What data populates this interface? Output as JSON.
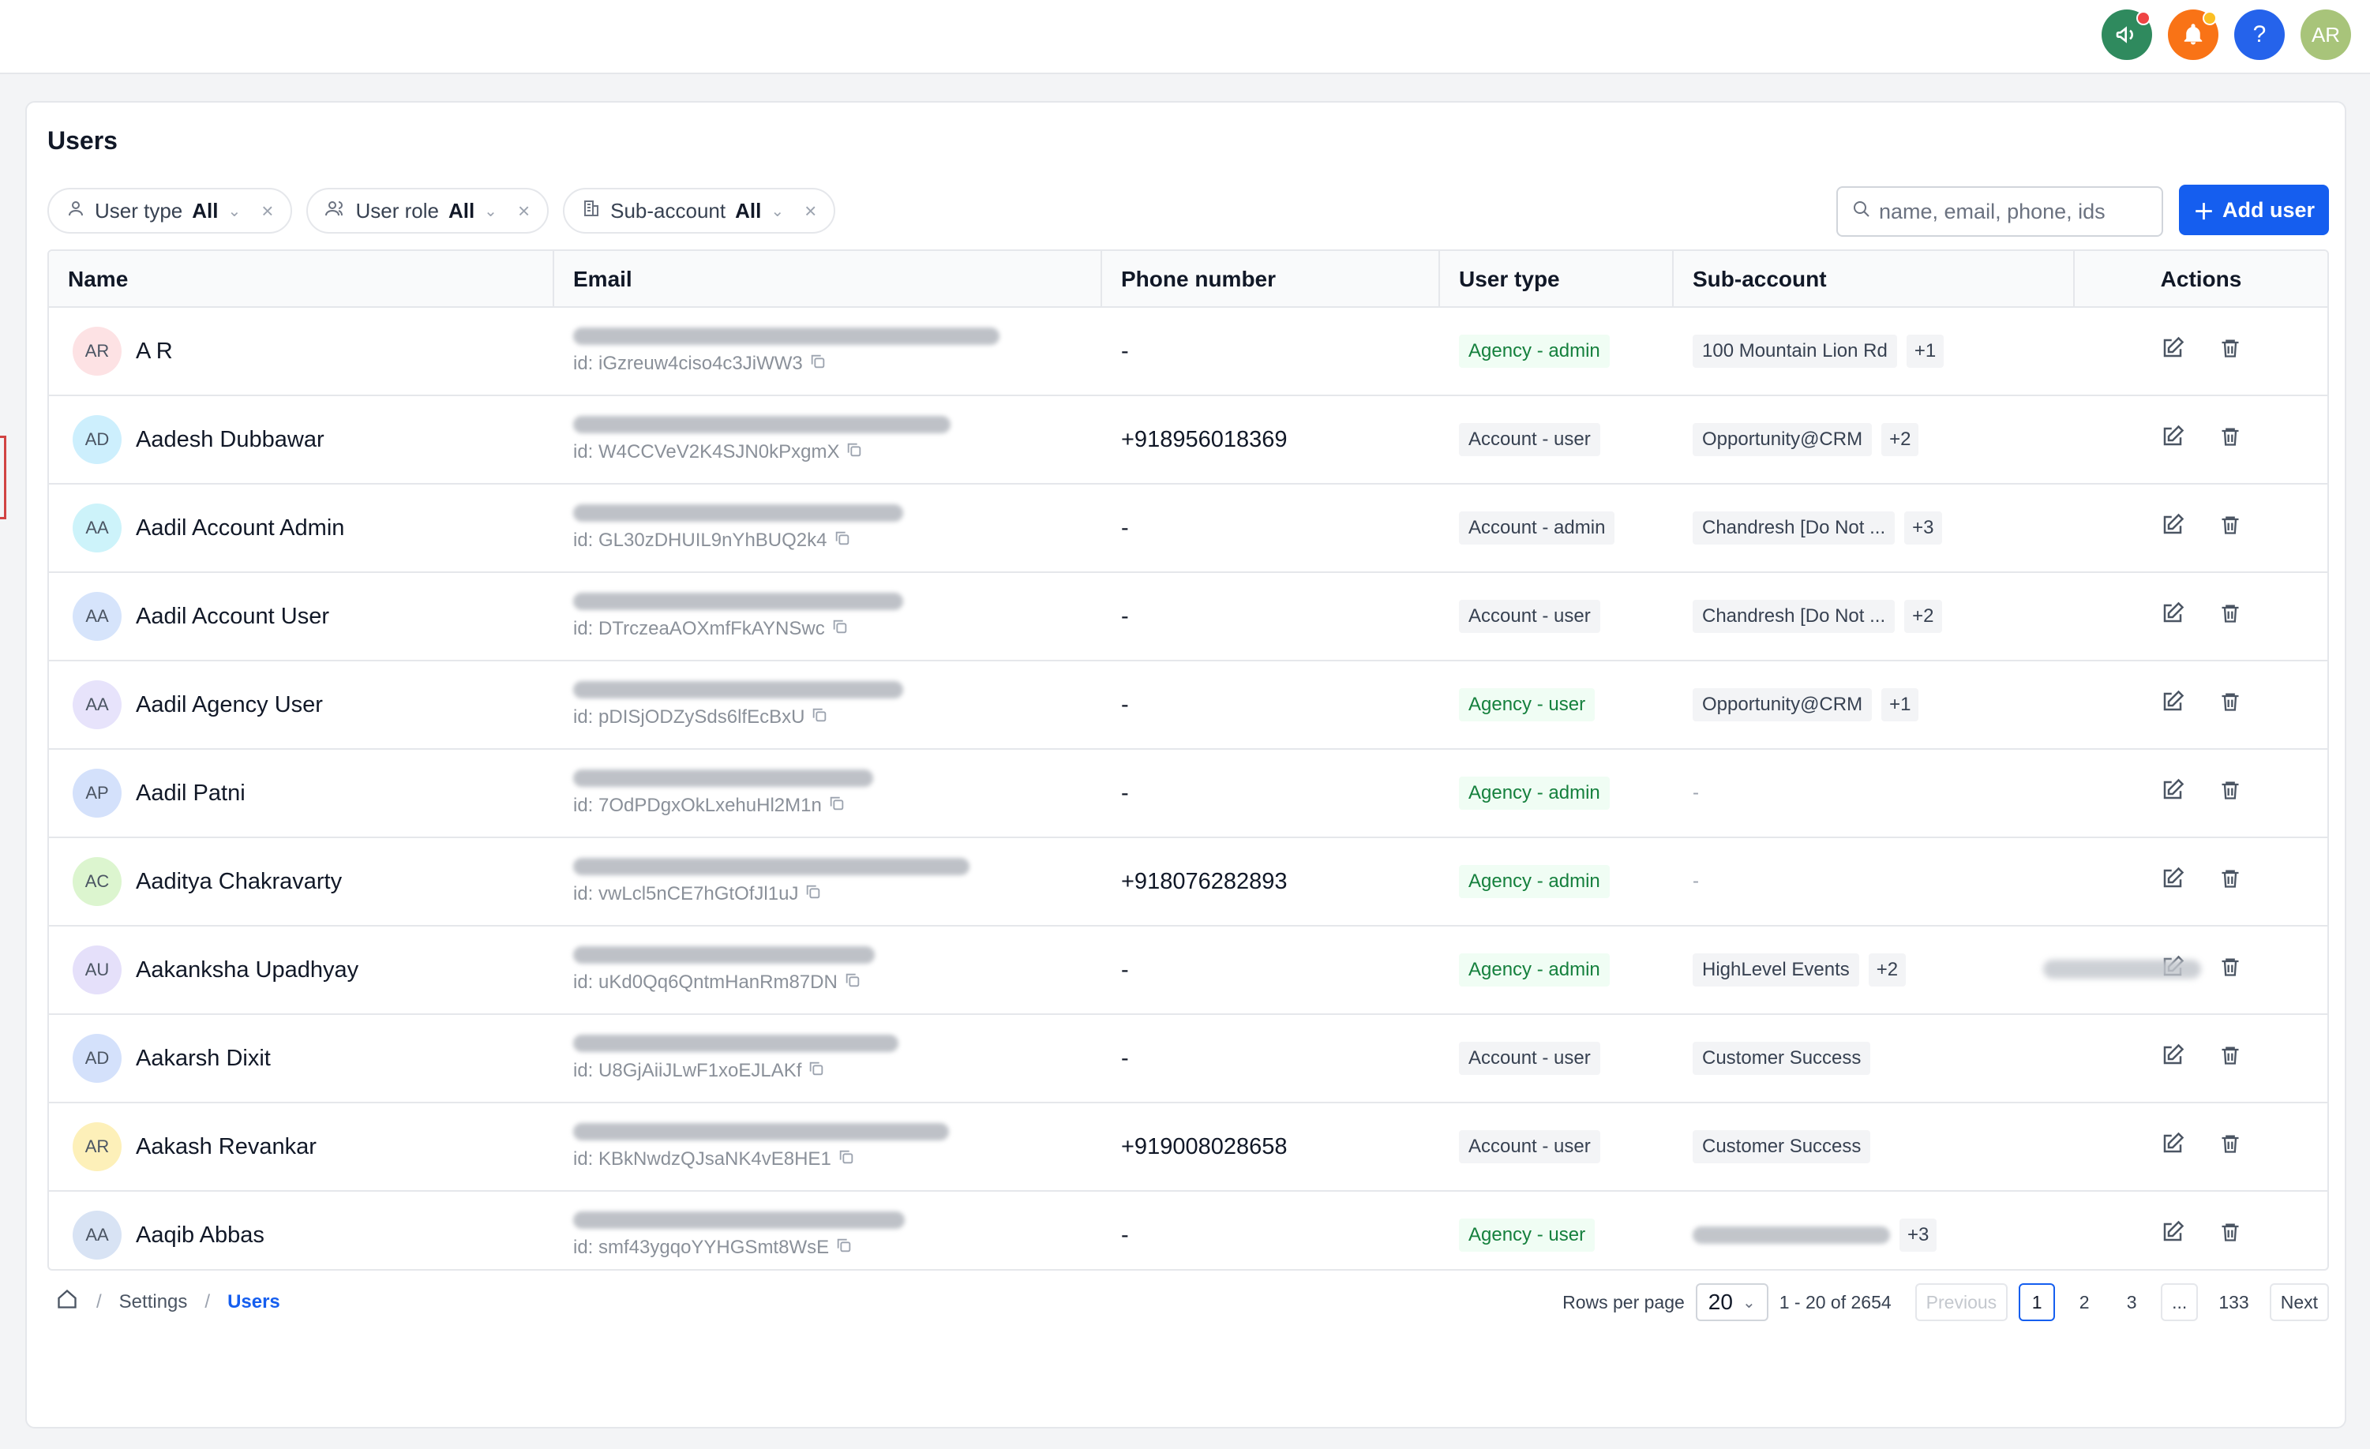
{
  "topbar": {
    "icons": [
      "megaphone-icon",
      "bell-icon",
      "help-icon"
    ],
    "help_glyph": "?",
    "avatar_initials": "AR"
  },
  "page": {
    "title": "Users"
  },
  "filters": [
    {
      "label": "User type",
      "value": "All",
      "icon": "user-icon"
    },
    {
      "label": "User role",
      "value": "All",
      "icon": "users-icon"
    },
    {
      "label": "Sub-account",
      "value": "All",
      "icon": "building-icon"
    }
  ],
  "search": {
    "placeholder": "name, email, phone, ids"
  },
  "add_button": {
    "label": "Add user"
  },
  "table": {
    "columns": [
      "Name",
      "Email",
      "Phone number",
      "User type",
      "Sub-account",
      "Actions"
    ],
    "rows": [
      {
        "initials": "AR",
        "avatar_color": "#fde2e4",
        "name": "A R",
        "id": "id: iGzreuw4ciso4c3JiWW3",
        "phone": "-",
        "user_type": "Agency - admin",
        "kind": "agency",
        "sub_account": "100 Mountain Lion Rd",
        "more": "+1"
      },
      {
        "initials": "AD",
        "avatar_color": "#cdeffd",
        "name": "Aadesh Dubbawar",
        "id": "id: W4CCVeV2K4SJN0kPxgmX",
        "phone": "+918956018369",
        "user_type": "Account - user",
        "kind": "account",
        "sub_account": "Opportunity@CRM",
        "more": "+2"
      },
      {
        "initials": "AA",
        "avatar_color": "#cdf3fa",
        "name": "Aadil Account Admin",
        "id": "id: GL30zDHUIL9nYhBUQ2k4",
        "phone": "-",
        "user_type": "Account - admin",
        "kind": "account",
        "sub_account": "Chandresh [Do Not ...",
        "more": "+3"
      },
      {
        "initials": "AA",
        "avatar_color": "#d6e4fb",
        "name": "Aadil Account User",
        "id": "id: DTrczeaAOXmfFkAYNSwc",
        "phone": "-",
        "user_type": "Account - user",
        "kind": "account",
        "sub_account": "Chandresh [Do Not ...",
        "more": "+2"
      },
      {
        "initials": "AA",
        "avatar_color": "#e7e3fb",
        "name": "Aadil Agency User",
        "id": "id: pDISjODZySds6lfEcBxU",
        "phone": "-",
        "user_type": "Agency - user",
        "kind": "agency",
        "sub_account": "Opportunity@CRM",
        "more": "+1"
      },
      {
        "initials": "AP",
        "avatar_color": "#d4e1fb",
        "name": "Aadil Patni",
        "id": "id: 7OdPDgxOkLxehuHl2M1n",
        "phone": "-",
        "user_type": "Agency - admin",
        "kind": "agency",
        "sub_account": "-",
        "more": ""
      },
      {
        "initials": "AC",
        "avatar_color": "#dcf5cf",
        "name": "Aaditya Chakravarty",
        "id": "id: vwLcl5nCE7hGtOfJl1uJ",
        "phone": "+918076282893",
        "user_type": "Agency - admin",
        "kind": "agency",
        "sub_account": "-",
        "more": ""
      },
      {
        "initials": "AU",
        "avatar_color": "#e5e0fa",
        "name": "Aakanksha Upadhyay",
        "id": "id: uKd0Qq6QntmHanRm87DN",
        "phone": "-",
        "user_type": "Agency - admin",
        "kind": "agency",
        "sub_account": "HighLevel Events",
        "more": "+2"
      },
      {
        "initials": "AD",
        "avatar_color": "#d4e1fb",
        "name": "Aakarsh Dixit",
        "id": "id: U8GjAiiJLwF1xoEJLAKf",
        "phone": "-",
        "user_type": "Account - user",
        "kind": "account",
        "sub_account": "Customer Success",
        "more": ""
      },
      {
        "initials": "AR",
        "avatar_color": "#fdf0b9",
        "name": "Aakash Revankar",
        "id": "id: KBkNwdzQJsaNK4vE8HE1",
        "phone": "+919008028658",
        "user_type": "Account - user",
        "kind": "account",
        "sub_account": "Customer Success",
        "more": ""
      },
      {
        "initials": "AA",
        "avatar_color": "#d8e3f4",
        "name": "Aaqib Abbas",
        "id": "id: smf43ygqoYYHGSmt8WsE",
        "phone": "-",
        "user_type": "Agency - user",
        "kind": "agency",
        "sub_account": "",
        "more": "+3"
      }
    ]
  },
  "footer": {
    "breadcrumb": [
      "Settings",
      "Users"
    ],
    "rows_per_page_label": "Rows per page",
    "rows_per_page": "20",
    "range": "1 - 20 of 2654",
    "previous": "Previous",
    "pages": [
      "1",
      "2",
      "3",
      "...",
      "133"
    ],
    "current_page": "1",
    "next": "Next"
  },
  "colors": {
    "primary": "#155eef",
    "agency_badge_text": "#15803d",
    "agency_badge_bg": "#f0fdf4"
  }
}
